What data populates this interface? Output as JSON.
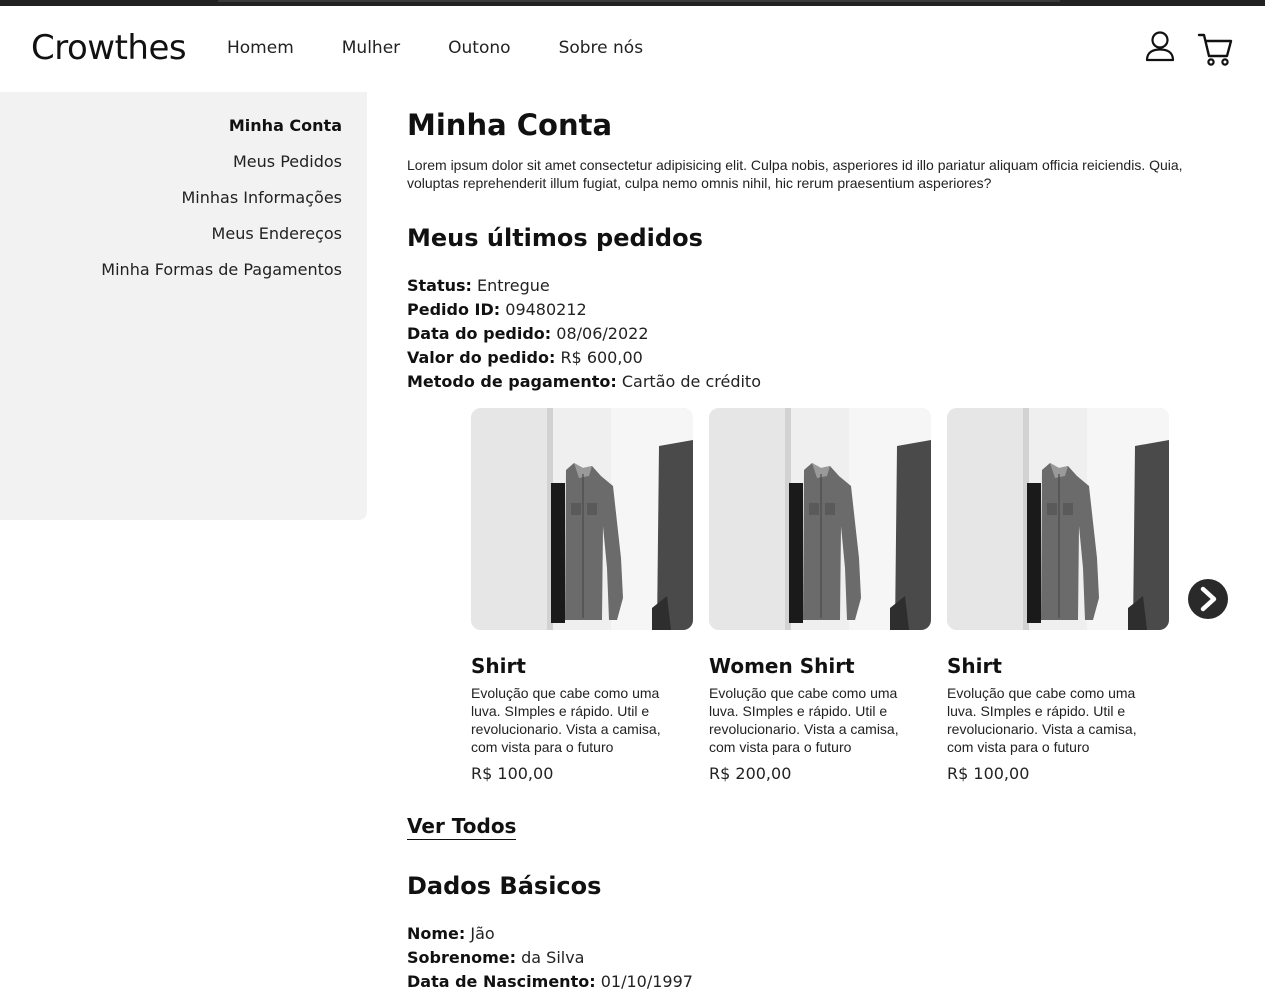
{
  "header": {
    "logo": "Crowthes",
    "nav": [
      "Homem",
      "Mulher",
      "Outono",
      "Sobre nós"
    ],
    "icons": [
      "user-icon",
      "cart-icon"
    ]
  },
  "sidebar": {
    "items": [
      {
        "label": "Minha Conta",
        "active": true
      },
      {
        "label": "Meus Pedidos"
      },
      {
        "label": "Minhas Informações"
      },
      {
        "label": "Meus Endereços"
      },
      {
        "label": "Minha Formas de Pagamentos"
      }
    ]
  },
  "main": {
    "title": "Minha Conta",
    "intro": "Lorem ipsum dolor sit amet consectetur adipisicing elit. Culpa nobis, asperiores id illo pariatur aliquam officia reiciendis. Quia, voluptas reprehenderit illum fugiat, culpa nemo omnis nihil, hic rerum praesentium asperiores?",
    "orders_title": "Meus últimos pedidos",
    "order": [
      {
        "label": "Status:",
        "value": "Entregue"
      },
      {
        "label": "Pedido ID:",
        "value": "09480212"
      },
      {
        "label": "Data do pedido:",
        "value": "08/06/2022"
      },
      {
        "label": "Valor do pedido:",
        "value": "R$ 600,00"
      },
      {
        "label": "Metodo de pagamento:",
        "value": "Cartão de crédito"
      }
    ],
    "products": [
      {
        "name": "Shirt",
        "desc": "Evolução que cabe como uma luva. SImples e rápido. Util e revolucionario. Vista a camisa, com vista para o futuro",
        "price": "R$ 100,00"
      },
      {
        "name": "Women Shirt",
        "desc": "Evolução que cabe como uma luva. SImples e rápido. Util e revolucionario. Vista a camisa, com vista para o futuro",
        "price": "R$ 200,00"
      },
      {
        "name": "Shirt",
        "desc": "Evolução que cabe como uma luva. SImples e rápido. Util e revolucionario. Vista a camisa, com vista para o futuro",
        "price": "R$ 100,00"
      }
    ],
    "see_all": "Ver Todos",
    "basic_title": "Dados Básicos",
    "basic": [
      {
        "label": "Nome:",
        "value": "Jão"
      },
      {
        "label": "Sobrenome:",
        "value": "da Silva"
      },
      {
        "label": "Data de Nascimento:",
        "value": "01/10/1997"
      }
    ]
  }
}
